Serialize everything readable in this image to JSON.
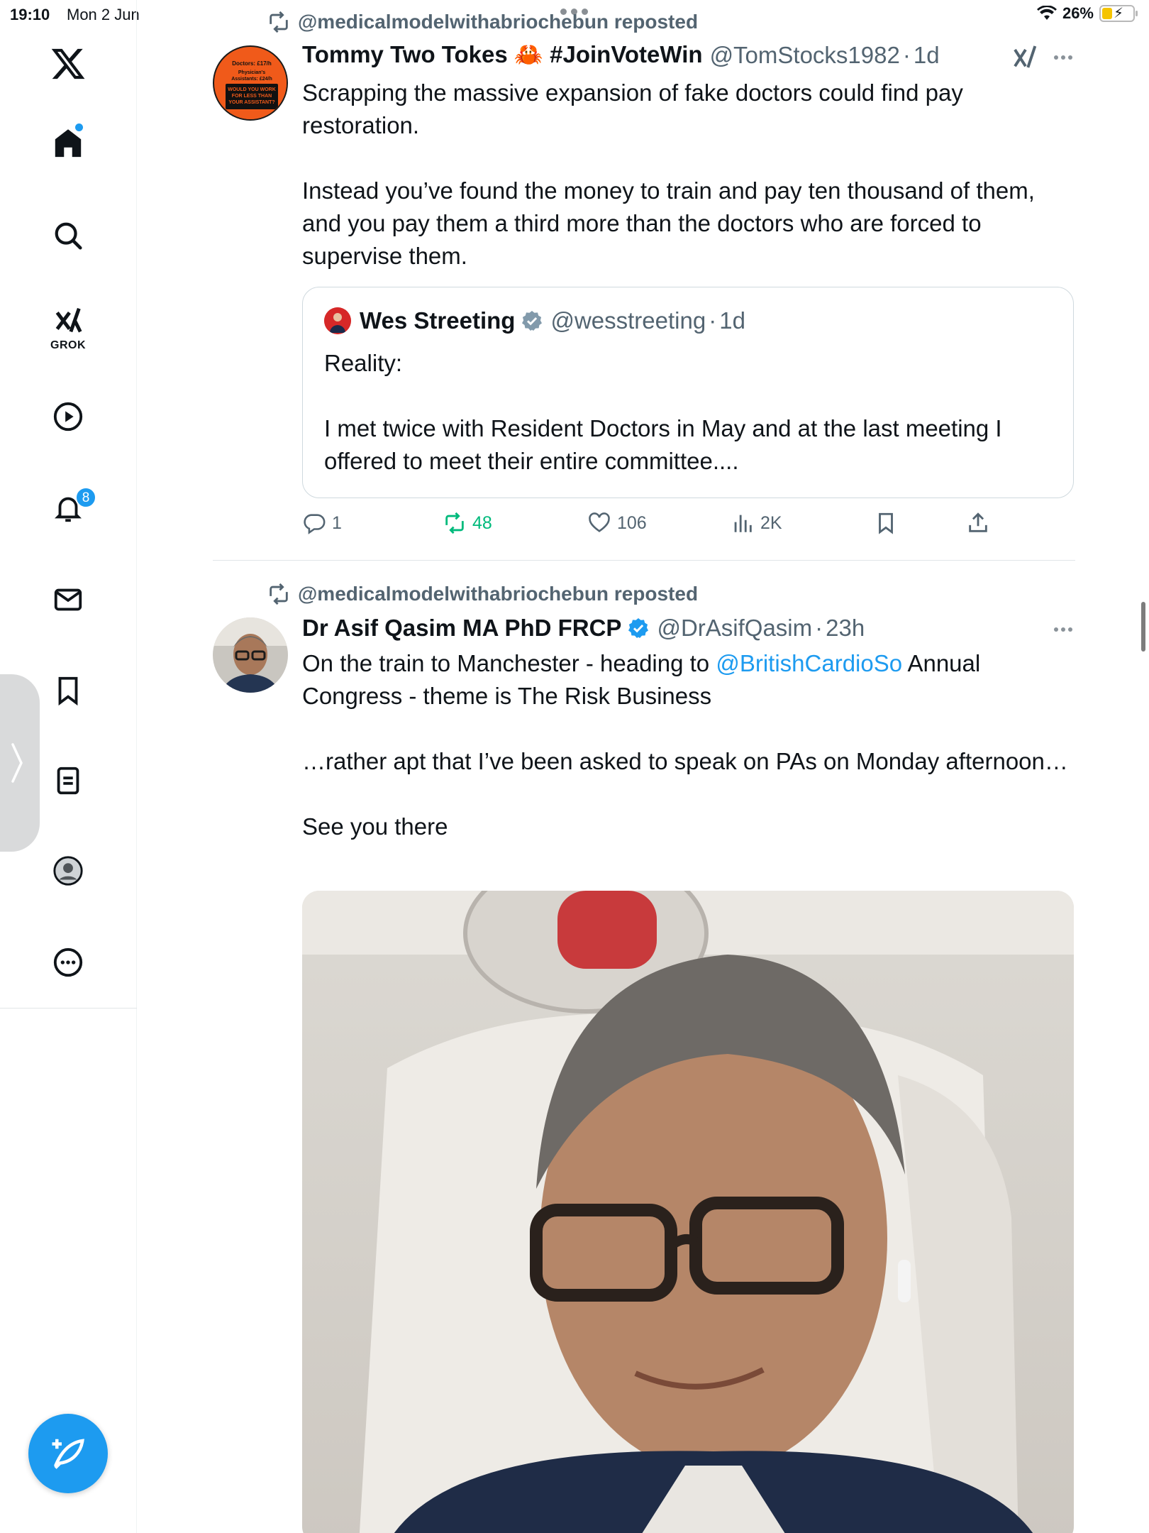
{
  "status_bar": {
    "time": "19:10",
    "date": "Mon 2 Jun",
    "battery": "26%"
  },
  "sidebar": {
    "grok_label": "GROK",
    "notifications_badge": "8",
    "icons": [
      "x-logo",
      "home-icon",
      "search-icon",
      "grok-icon",
      "video-icon",
      "bell-icon",
      "mail-icon",
      "bookmark-icon",
      "lists-icon",
      "profile-icon",
      "more-icon",
      "compose-icon"
    ]
  },
  "tweet1": {
    "repost_label": "@medicalmodelwithabriochebun reposted",
    "name": "Tommy Two Tokes 🦀 #JoinVoteWin",
    "handle": "@TomStocks1982",
    "time": "1d",
    "avatar_text": [
      "Doctors: £17/h",
      "Physician's Assistants: £24/h",
      "WOULD YOU WORK FOR LESS THAN YOUR ASSISTANT?"
    ],
    "text": [
      "Scrapping the massive expansion of fake doctors could find pay restoration.",
      "Instead you’ve found the money to train and pay ten thousand of them, and you pay them a third more than the doctors who are forced to supervise them."
    ],
    "quote": {
      "name": "Wes Streeting",
      "handle": "@wesstreeting",
      "time": "1d",
      "text": [
        "Reality:",
        "I met twice with Resident Doctors in May and at the last meeting I offered to meet their entire committee...."
      ]
    },
    "stats": {
      "replies": "1",
      "reposts": "48",
      "likes": "106",
      "views": "2K"
    }
  },
  "tweet2": {
    "repost_label": "@medicalmodelwithabriochebun reposted",
    "name": "Dr Asif Qasim MA PhD FRCP",
    "handle": "@DrAsifQasim",
    "time": "23h",
    "text_line1_before": "On the train to Manchester - heading to ",
    "text_link": "@BritishCardioSo",
    "text_line1_after": " Annual Congress - theme is The Risk Business",
    "text_p2": "…rather apt that I’ve been asked to speak on PAs on Monday afternoon…",
    "text_p3": "See you there"
  },
  "colors": {
    "accent": "#1d9bf0",
    "repost_green": "#00ba7c",
    "secondary_text": "#536471"
  }
}
